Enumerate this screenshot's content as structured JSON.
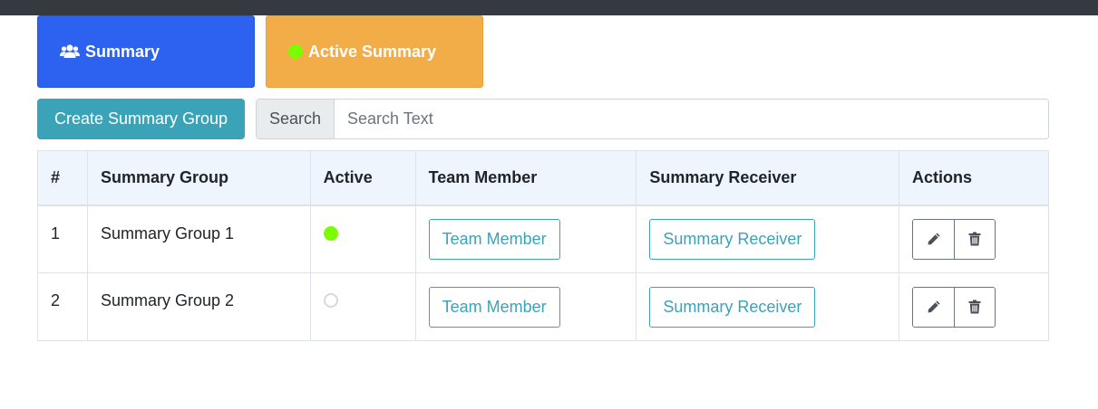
{
  "cards": {
    "summary_label": "Summary",
    "summary_icon": "users-icon",
    "active_label": "Active Summary",
    "active_icon": "green-dot-icon"
  },
  "toolbar": {
    "create_label": "Create Summary Group",
    "search_label": "Search",
    "search_placeholder": "Search Text"
  },
  "table": {
    "headers": [
      "#",
      "Summary Group",
      "Active",
      "Team Member",
      "Summary Receiver",
      "Actions"
    ],
    "rows": [
      {
        "num": "1",
        "group": "Summary Group 1",
        "active": true,
        "team_label": "Team Member",
        "receiver_label": "Summary Receiver"
      },
      {
        "num": "2",
        "group": "Summary Group 2",
        "active": false,
        "team_label": "Team Member",
        "receiver_label": "Summary Receiver"
      }
    ],
    "action_icons": [
      "pencil-icon",
      "trash-icon"
    ]
  },
  "colors": {
    "summary_card": "#2d62f0",
    "active_card": "#f3ad48",
    "teal": "#3aa3b8",
    "active_dot": "#7cfc00",
    "topbar": "#343a40"
  }
}
